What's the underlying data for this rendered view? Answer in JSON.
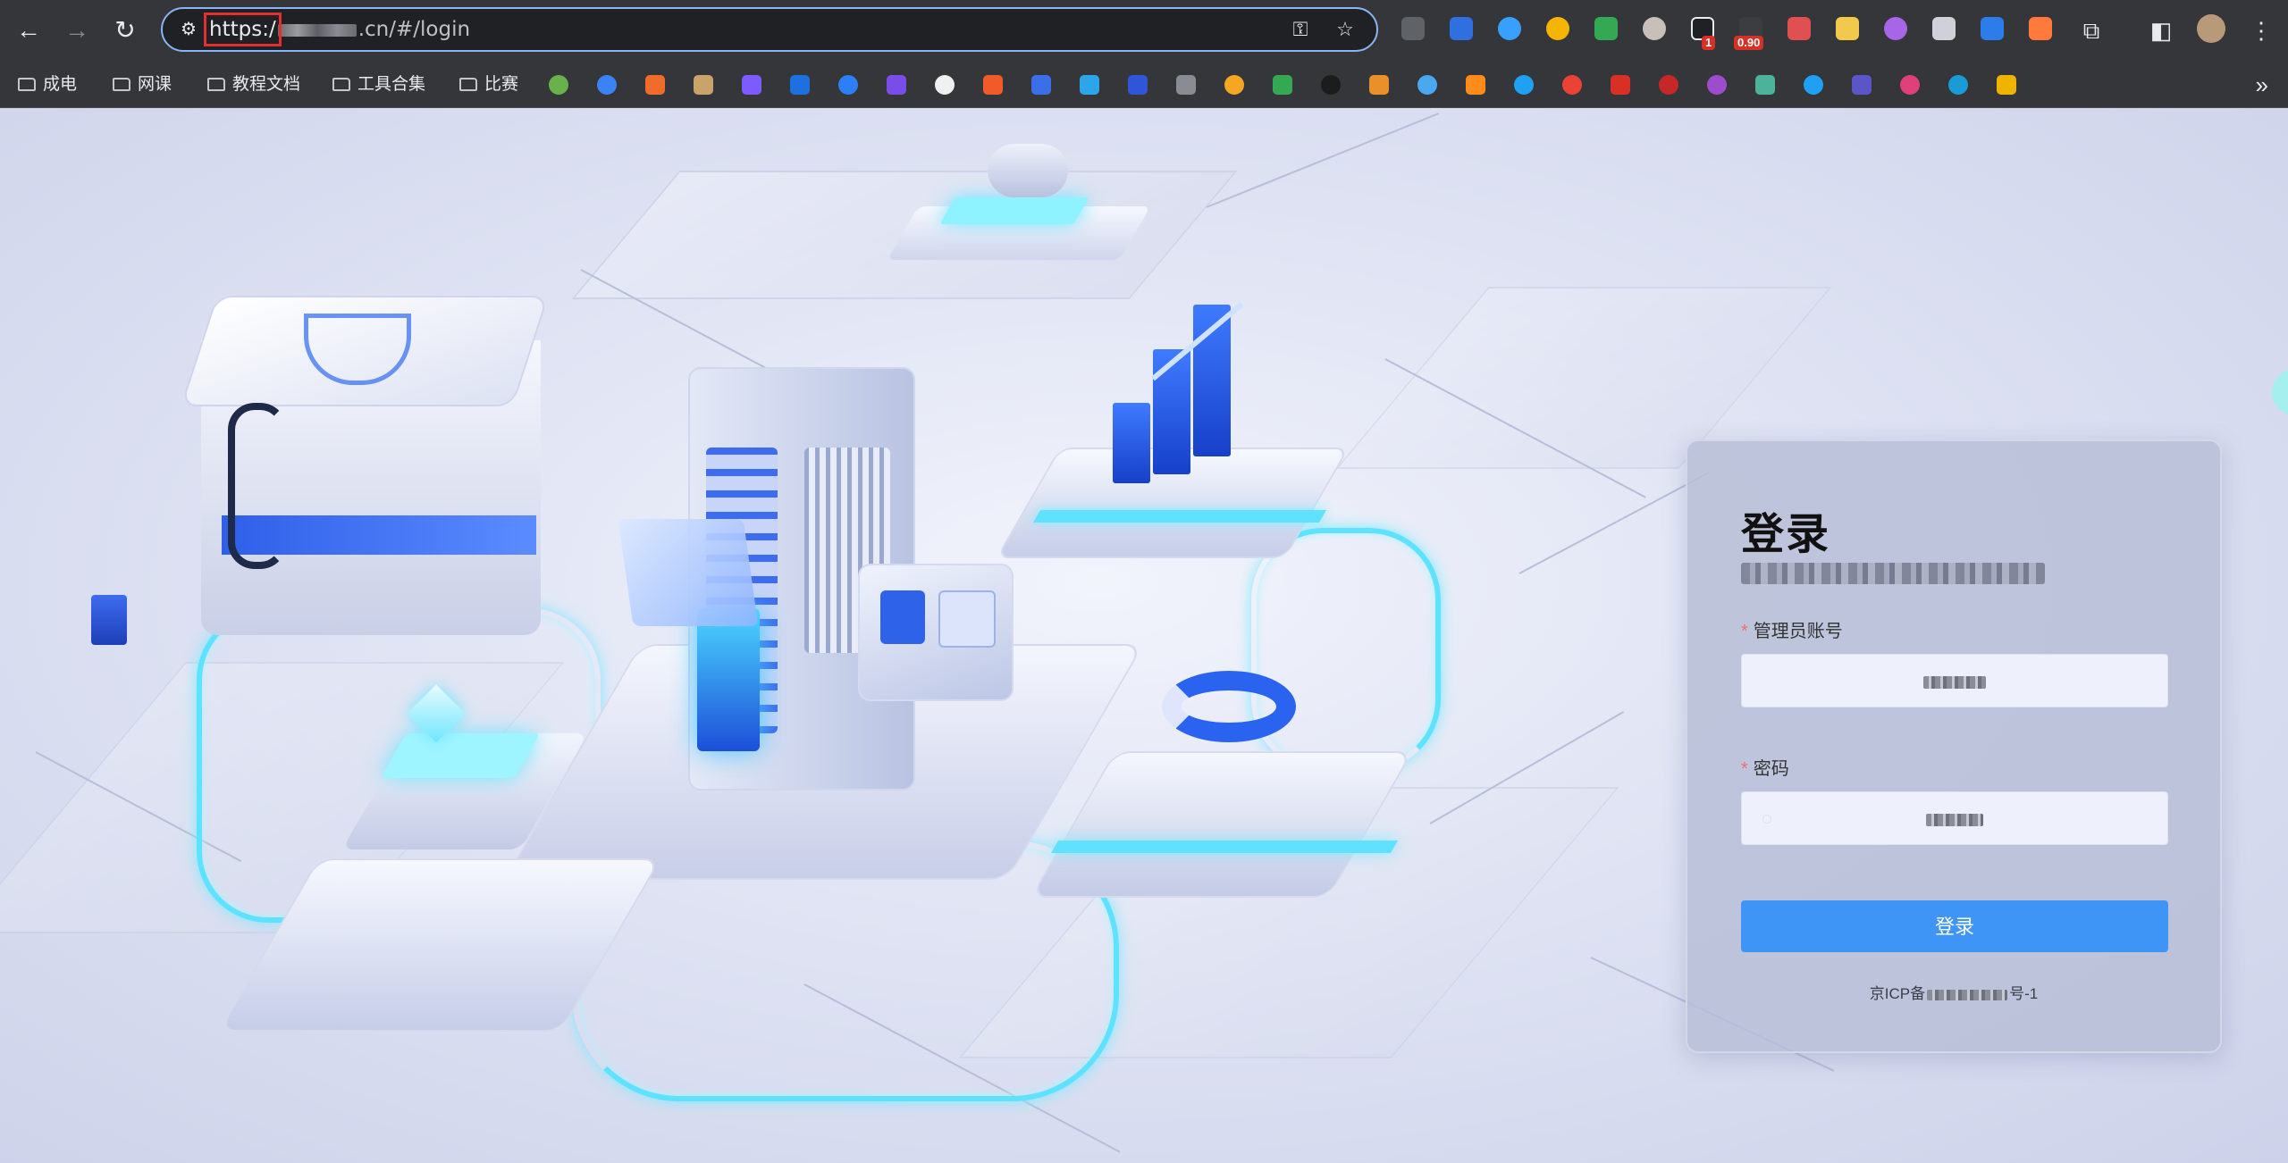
{
  "browser": {
    "url_scheme": "https:/",
    "url_domain_suffix": ".cn/#/login",
    "extension_badges": {
      "first": "1",
      "second": "0.90"
    }
  },
  "bookmarks": {
    "folders": [
      "成电",
      "网课",
      "教程文档",
      "工具合集",
      "比赛"
    ],
    "more": "»"
  },
  "login": {
    "title": "登录",
    "account_label": "管理员账号",
    "password_label": "密码",
    "submit_label": "登录",
    "icp_prefix": "京ICP备",
    "icp_suffix": "号-1"
  },
  "colors": {
    "accent": "#3f95f5",
    "required_mark": "#f56c6c",
    "glow": "#5ee2ff",
    "focus_outline": "#8ab4f8"
  }
}
